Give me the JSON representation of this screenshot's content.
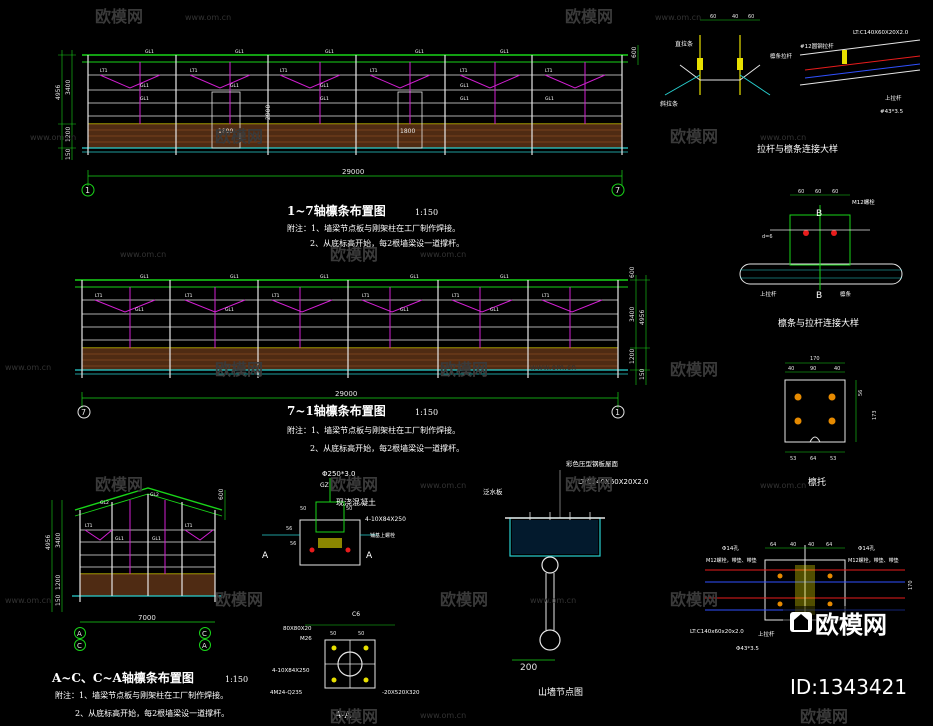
{
  "watermark": {
    "brand": "欧模网",
    "url": "www.om.cn"
  },
  "badge": {
    "brand": "欧模网",
    "id": "ID:1343421"
  },
  "elev1": {
    "title": "1~7轴檩条布置图",
    "scale": "1:150",
    "note1": "附注：1、墙梁节点板与刚架柱在工厂制作焊接。",
    "note2": "2、从底标高开始，每2根墙梁设一道撑杆。",
    "span": "29000",
    "axis_left": "1",
    "axis_right": "7",
    "dims": [
      "600",
      "3400",
      "4956",
      "1200",
      "150"
    ],
    "door1": "1800",
    "door2": "2900",
    "door3": "1800"
  },
  "elev2": {
    "title": "7~1轴檩条布置图",
    "scale": "1:150",
    "note1": "附注：1、墙梁节点板与刚架柱在工厂制作焊接。",
    "note2": "2、从底标高开始，每2根墙梁设一道撑杆。",
    "span": "29000",
    "axis_left": "7",
    "axis_right": "1",
    "dims": [
      "600",
      "3400",
      "4956",
      "1200",
      "150"
    ]
  },
  "elev3": {
    "title": "A~C、C~A轴檩条布置图",
    "scale": "1:150",
    "note1": "附注：1、墙梁节点板与刚架柱在工厂制作焊接。",
    "note2": "2、从底标高开始，每2根墙梁设一道撑杆。",
    "span": "7000",
    "axis_left": "A",
    "axis_left2": "C",
    "axis_right": "C",
    "axis_right2": "A",
    "dims": [
      "600",
      "3400",
      "4956",
      "1200",
      "150"
    ]
  },
  "labels": {
    "gl1": "GL1",
    "lt1": "LT1",
    "gl2": "GL2"
  },
  "detail1": {
    "title": "拉杆与檩条连接大样",
    "labels": [
      "直拉条",
      "斜拉条",
      "#12圆钢拉杆",
      "檩条拉杆",
      "LT:C140X60X20X2.0",
      "上拉杆",
      "#43*3.5"
    ],
    "dims": [
      "60",
      "40",
      "60"
    ]
  },
  "detail2": {
    "title": "檩条与拉杆连接大样",
    "labels": [
      "M12螺栓",
      "上拉杆",
      "B",
      "B",
      "檩条"
    ],
    "dims": [
      "60",
      "60",
      "60",
      "d=6"
    ]
  },
  "detail3": {
    "title": "檩托",
    "dims": [
      "170",
      "40",
      "90",
      "40",
      "53",
      "64",
      "53",
      "56",
      "173"
    ]
  },
  "detail4": {
    "title": "现浇混凝土",
    "labels": [
      "Φ250*3.0",
      "GZ",
      "4-10X84X250",
      "A",
      "A",
      "铺基上螺栓"
    ],
    "dims": [
      "50",
      "50",
      "56",
      "56"
    ]
  },
  "detail5": {
    "title": "A-A",
    "labels": [
      "80X80X20",
      "C6",
      "M26",
      "4-10X84X250",
      "4M24-Q235",
      "-20X520X320"
    ],
    "dims": [
      "50",
      "50"
    ]
  },
  "detail6": {
    "title": "山墙节点图",
    "labels": [
      "彩色压型钢板屋面",
      "LT:C140X60X20X2.0",
      "泛水板"
    ],
    "dims": [
      "200"
    ]
  },
  "detail7": {
    "labels": [
      "Φ14孔",
      "Φ14孔",
      "M12螺栓，带垫、带垫",
      "M12螺栓，带垫、带垫",
      "上拉杆",
      "LT:C140x60x20x2.0",
      "Φ43*3.5"
    ],
    "dims": [
      "64",
      "40",
      "40",
      "64",
      "45",
      "170"
    ]
  }
}
